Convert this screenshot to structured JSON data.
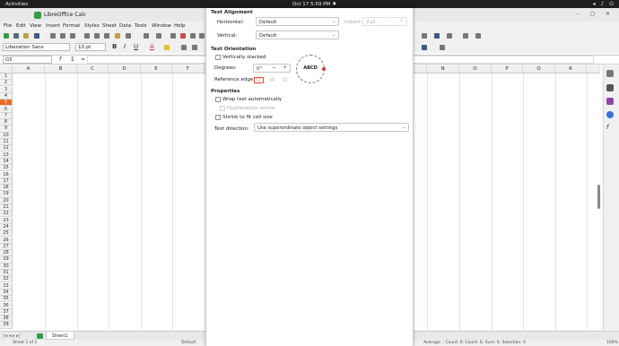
{
  "topbar": {
    "activities": "Activities",
    "clock": "Oct 17  5:59 PM"
  },
  "window": {
    "title": "LibreOffice Calc"
  },
  "menu": [
    "File",
    "Edit",
    "View",
    "Insert",
    "Format",
    "Styles",
    "Sheet",
    "Data",
    "Tools",
    "Window",
    "Help"
  ],
  "toolbar": {
    "font_name": "Liberation Sans",
    "font_size": "10 pt"
  },
  "formula": {
    "cell_ref": "G5",
    "fx": "f",
    "sigma": "Σ",
    "equals": "="
  },
  "columns": [
    "A",
    "B",
    "C",
    "D",
    "E",
    "F",
    "G",
    "H",
    "I",
    "J",
    "K",
    "L",
    "M",
    "N",
    "O",
    "P",
    "Q",
    "R"
  ],
  "rows": [
    "1",
    "2",
    "3",
    "4",
    "5",
    "6",
    "7",
    "8",
    "9",
    "10",
    "11",
    "12",
    "13",
    "14",
    "15",
    "16",
    "17",
    "18",
    "19",
    "20",
    "21",
    "22",
    "23",
    "24",
    "25",
    "26",
    "27",
    "28",
    "29",
    "30",
    "31",
    "32",
    "33",
    "34",
    "35",
    "36",
    "37",
    "38",
    "39"
  ],
  "selected_row": "5",
  "sheet_tab": "Sheet1",
  "status": {
    "sheet": "Sheet 1 of 1",
    "style": "Default",
    "summary": "Average: ; Count: 0; Count: 0; Sum: 0; Selection: 0",
    "zoom": "100%"
  },
  "dialog": {
    "text_alignment": "Text Alignment",
    "horizontal_label": "Horizontal:",
    "horizontal_value": "Default",
    "indent_label": "Indent:",
    "indent_value": "0 pt",
    "vertical_label": "Vertical:",
    "vertical_value": "Default",
    "text_orientation": "Text Orientation",
    "vertically_stacked": "Vertically stacked",
    "degrees_label": "Degrees:",
    "degrees_value": "0°",
    "dial_text": "ABCD",
    "reference_edge": "Reference edge:",
    "properties": "Properties",
    "wrap_text": "Wrap text automatically",
    "hyphenation": "Hyphenation active",
    "shrink": "Shrink to fit cell size",
    "text_direction_label": "Text direction:",
    "text_direction_value": "Use superordinate object settings"
  },
  "colors": {
    "accent": "#e86b24",
    "selected_edge": "#e8401c",
    "dial_dot": "#e03030",
    "app_icon": "#2f9e44"
  }
}
